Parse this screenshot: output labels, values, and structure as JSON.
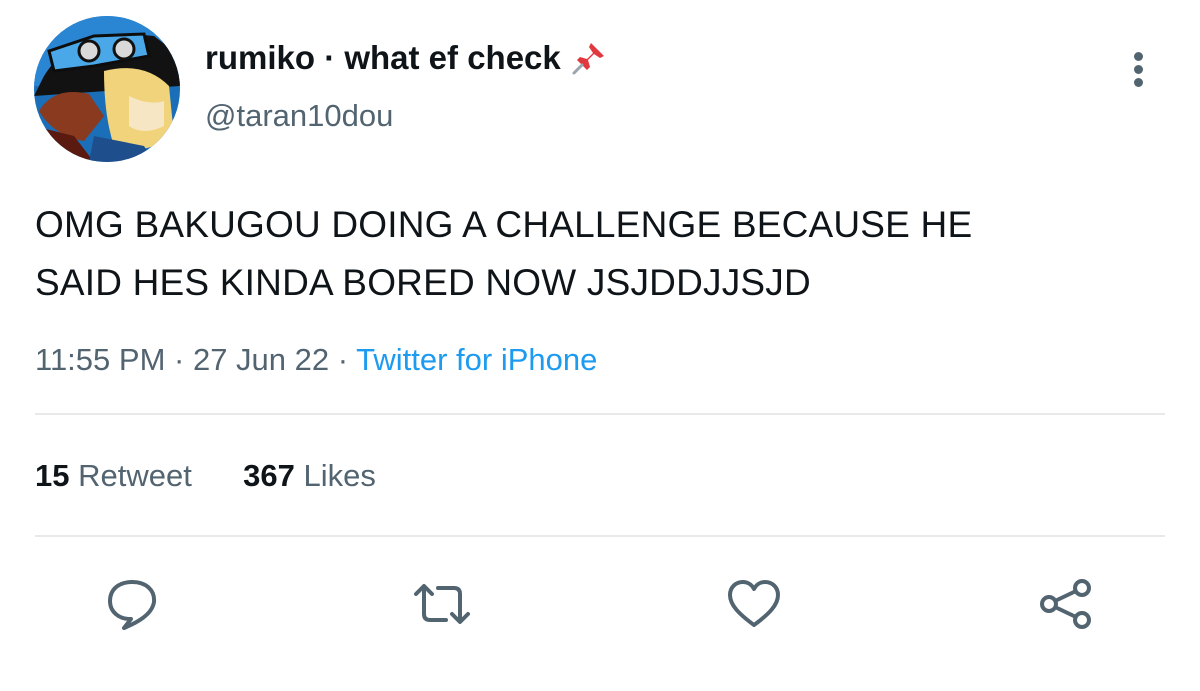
{
  "author": {
    "display_name": "rumiko · what ef check",
    "handle": "@taran10dou",
    "pinned_icon": "pushpin-icon"
  },
  "tweet": {
    "text_line1": "OMG BAKUGOU DOING A CHALLENGE BECAUSE HE",
    "text_line2": "SAID HES KINDA BORED NOW JSJDDJJSJD",
    "time": "11:55 PM",
    "date": "27 Jun 22",
    "source": "Twitter for iPhone",
    "separator": " · "
  },
  "stats": {
    "retweets_count": "15",
    "retweets_label": "Retweet",
    "likes_count": "367",
    "likes_label": "Likes"
  },
  "actions": [
    {
      "icon": "reply-icon"
    },
    {
      "icon": "retweet-icon"
    },
    {
      "icon": "like-icon"
    },
    {
      "icon": "share-icon"
    }
  ],
  "colors": {
    "accent": "#1d9bf0",
    "secondary_text": "#536471",
    "primary_text": "#0f1419",
    "divider": "#e7e9ea"
  }
}
